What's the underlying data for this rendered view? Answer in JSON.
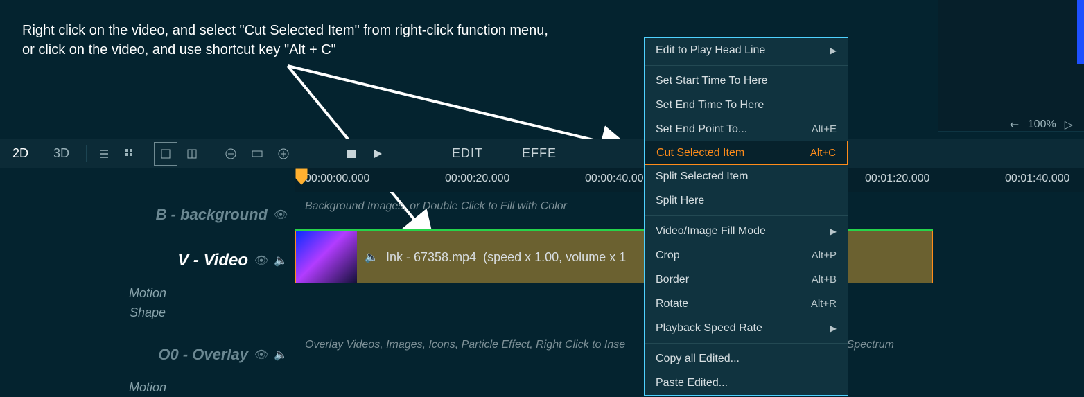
{
  "instruction": {
    "line1": "Right click on the video, and select \"Cut Selected Item\" from right-click function menu,",
    "line2": "or click on the video, and use shortcut key \"Alt + C\""
  },
  "zoom": {
    "percent": "100%"
  },
  "toolbar": {
    "tabs": {
      "d2": "2D",
      "d3": "3D"
    },
    "edit": "EDIT",
    "effect": "EFFE"
  },
  "ruler": {
    "t0": "00:00:00.000",
    "t1": "00:00:20.000",
    "t2": "00:00:40.00",
    "t3": "00:01:20.000",
    "t4": "00:01:40.000"
  },
  "tracks": {
    "bg": {
      "label": "B - background",
      "hint": "Background Images, or Double Click to Fill with Color"
    },
    "video": {
      "label": "V - Video"
    },
    "motion": {
      "label": "Motion"
    },
    "shape": {
      "label": "Shape"
    },
    "overlay": {
      "label": "O0 - Overlay",
      "hint_left": "Overlay Videos, Images, Icons, Particle Effect, Right Click to Inse",
      "hint_right": "o Spectrum"
    },
    "ov_motion": {
      "label": "Motion"
    }
  },
  "clip": {
    "filename": "Ink - 67358.mp4",
    "meta": "(speed x 1.00, volume x 1"
  },
  "menu": {
    "edit_playhead": {
      "label": "Edit to Play Head Line"
    },
    "set_start": {
      "label": "Set Start Time To Here"
    },
    "set_end": {
      "label": "Set End Time To Here"
    },
    "set_end_point": {
      "label": "Set End Point To...",
      "shortcut": "Alt+E"
    },
    "cut_selected": {
      "label": "Cut Selected Item",
      "shortcut": "Alt+C"
    },
    "split_selected": {
      "label": "Split Selected Item"
    },
    "split_here": {
      "label": "Split Here"
    },
    "fill_mode": {
      "label": "Video/Image Fill Mode"
    },
    "crop": {
      "label": "Crop",
      "shortcut": "Alt+P"
    },
    "border": {
      "label": "Border",
      "shortcut": "Alt+B"
    },
    "rotate": {
      "label": "Rotate",
      "shortcut": "Alt+R"
    },
    "playback_speed": {
      "label": "Playback Speed Rate"
    },
    "copy_edited": {
      "label": "Copy all Edited..."
    },
    "paste_edited": {
      "label": "Paste Edited..."
    }
  }
}
